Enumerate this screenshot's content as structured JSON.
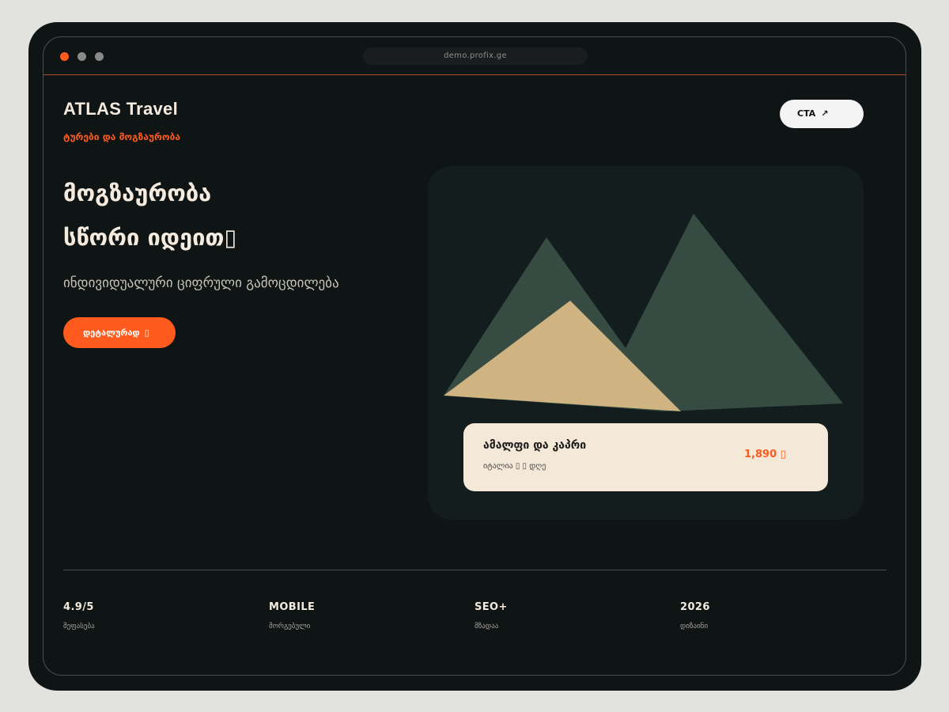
{
  "browser": {
    "url": "demo.profix.ge"
  },
  "brand": {
    "title": "ATLAS Travel",
    "subtitle": "ტურები და მოგზაურობა"
  },
  "header": {
    "cta_label": "CTA",
    "cta_icon": "↗"
  },
  "hero": {
    "line1": "მოგზაურობა",
    "line2": "სწორი იდეით",
    "line2_glyph": "▯",
    "subtitle": "ინდივიდუალური ციფრული გამოცდილება",
    "button_label": "დეტალურად",
    "button_icon": "▯"
  },
  "card": {
    "title": "ამალფი და კაპრი",
    "meta": "იტალია ▯ ▯ დღე",
    "price": "1,890 ▯"
  },
  "stats": [
    {
      "value": "4.9/5",
      "label": "შეფასება"
    },
    {
      "value": "MOBILE",
      "label": "მორგებული"
    },
    {
      "value": "SEO+",
      "label": "მზადაა"
    },
    {
      "value": "2026",
      "label": "დიზაინი"
    }
  ],
  "colors": {
    "accent": "#ff5b1f",
    "background": "#0f1515",
    "cream": "#f4eadd",
    "mountain_dark": "#364c42",
    "mountain_sand": "#cfb380"
  }
}
